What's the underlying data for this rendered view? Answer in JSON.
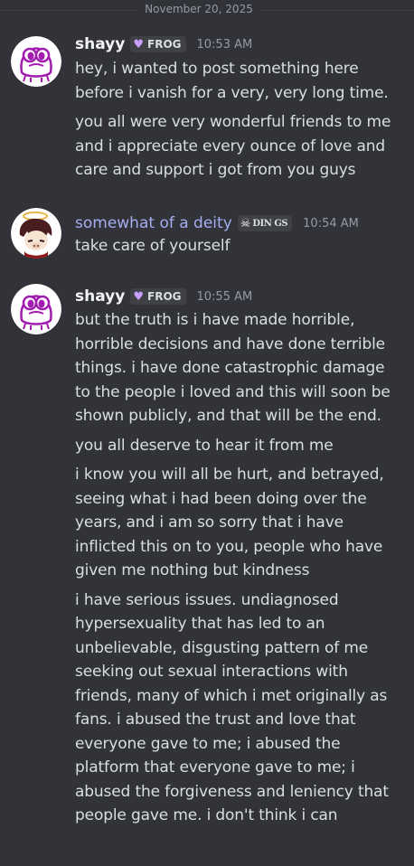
{
  "date_divider": "November 20, 2025",
  "messages": [
    {
      "author": "shayy",
      "tag": "FROG",
      "tag_icon": "purple-heart-icon",
      "time": "10:53 AM",
      "paragraphs": [
        "hey, i wanted to post something here before i vanish for a very, very long time.",
        "you all were very wonderful friends to me and i appreciate every ounce of love and care and support i got from you guys"
      ]
    },
    {
      "author": "somewhat of a deity",
      "tag": "DIN GS",
      "tag_icon": "skull-icon",
      "time": "10:54 AM",
      "paragraphs": [
        "take care of yourself"
      ]
    },
    {
      "author": "shayy",
      "tag": "FROG",
      "tag_icon": "purple-heart-icon",
      "time": "10:55 AM",
      "paragraphs": [
        "but the truth is i have made horrible, horrible decisions and have done terrible things. i have done catastrophic damage to the people i loved and this will soon be shown publicly, and that will be the end.",
        "you all deserve to hear it from me",
        "i know you will all be hurt, and betrayed, seeing what i had been doing over the years, and i am so sorry that i have inflicted this on to you, people who have given me nothing but kindness",
        "i have serious issues. undiagnosed hypersexuality that has led to an unbelievable, disgusting pattern of me seeking out sexual interactions with friends, many of which i met originally as fans. i abused the trust and love that everyone gave to me; i abused the platform that everyone gave to me; i abused the forgiveness and leniency that people gave me. i don't think i can"
      ]
    }
  ],
  "colors": {
    "background": "#313338",
    "text": "#dbdee1",
    "muted": "#949ba4",
    "username": "#f2f3f5",
    "deity_username": "#a5acf0",
    "tag_bg": "#3f4147",
    "frog_purple": "#a21caf"
  }
}
